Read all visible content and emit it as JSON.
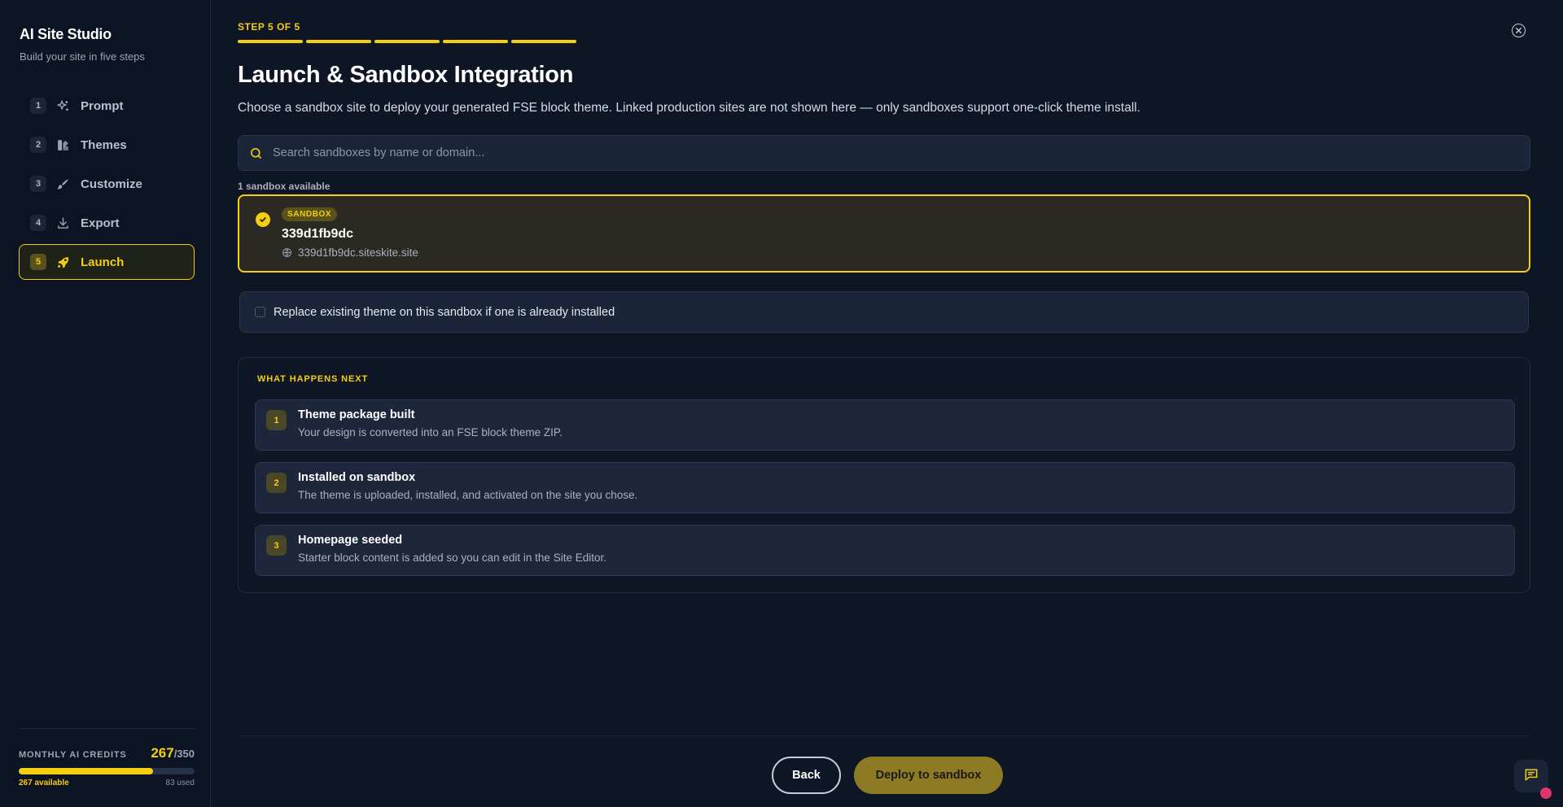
{
  "sidebar": {
    "brand": "AI Site Studio",
    "subtitle": "Build your site in five steps",
    "items": [
      {
        "num": "1",
        "label": "Prompt",
        "icon": "sparkles-icon"
      },
      {
        "num": "2",
        "label": "Themes",
        "icon": "swatches-icon"
      },
      {
        "num": "3",
        "label": "Customize",
        "icon": "brush-icon"
      },
      {
        "num": "4",
        "label": "Export",
        "icon": "download-icon"
      },
      {
        "num": "5",
        "label": "Launch",
        "icon": "rocket-icon",
        "active": true
      }
    ],
    "credits": {
      "title": "MONTHLY AI CREDITS",
      "value": "267",
      "total": "/350",
      "fraction_available": 0.763,
      "available_label": "267 available",
      "used_label": "83 used"
    }
  },
  "header": {
    "step_label": "STEP 5 OF 5",
    "title": "Launch & Sandbox Integration",
    "description": "Choose a sandbox site to deploy your generated FSE block theme. Linked production sites are not shown here — only sandboxes support one-click theme install."
  },
  "search": {
    "placeholder": "Search sandboxes by name or domain..."
  },
  "sandboxes": {
    "count_label": "1 sandbox available",
    "items": [
      {
        "badge": "SANDBOX",
        "name": "339d1fb9dc",
        "domain": "339d1fb9dc.siteskite.site",
        "selected": true
      }
    ]
  },
  "replace_option": {
    "label": "Replace existing theme on this sandbox if one is already installed",
    "checked": false
  },
  "next": {
    "title": "WHAT HAPPENS NEXT",
    "steps": [
      {
        "num": "1",
        "title": "Theme package built",
        "desc": "Your design is converted into an FSE block theme ZIP."
      },
      {
        "num": "2",
        "title": "Installed on sandbox",
        "desc": "The theme is uploaded, installed, and activated on the site you chose."
      },
      {
        "num": "3",
        "title": "Homepage seeded",
        "desc": "Starter block content is added so you can edit in the Site Editor."
      }
    ]
  },
  "actions": {
    "back": "Back",
    "deploy": "Deploy to sandbox"
  },
  "colors": {
    "accent": "#f5cf0f",
    "background": "#0e1525",
    "panel": "#1b2539"
  }
}
